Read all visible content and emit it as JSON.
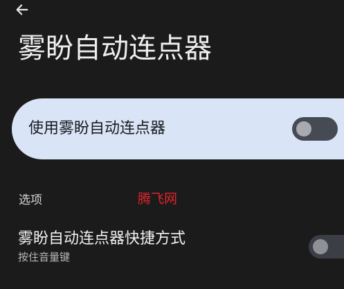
{
  "header": {
    "back_icon": "arrow-left-icon",
    "title": "雾盼自动连点器"
  },
  "main_switch": {
    "label": "使用雾盼自动连点器",
    "checked": false
  },
  "options_section": {
    "header": "选项"
  },
  "watermark": "腾飞网",
  "shortcut": {
    "title": "雾盼自动连点器快捷方式",
    "subtitle": "按住音量键",
    "checked": false
  },
  "colors": {
    "background": "#1b1b1b",
    "card": "#d9e4f7",
    "watermark": "#e0242c"
  }
}
